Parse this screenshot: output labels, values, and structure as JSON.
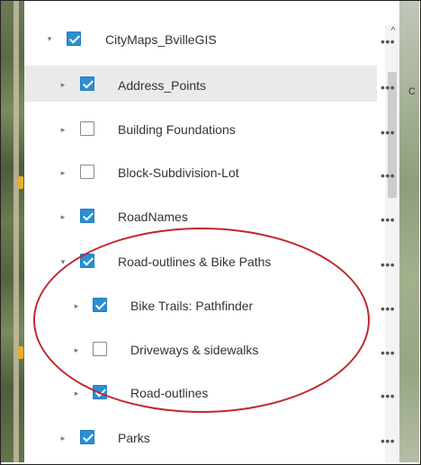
{
  "layers": [
    {
      "label": "CityMaps_BvilleGIS",
      "checked": true,
      "expander": "▾",
      "level": 0
    },
    {
      "label": "Address_Points",
      "checked": true,
      "expander": "▸",
      "level": 1,
      "highlighted": true
    },
    {
      "label": "Building Foundations",
      "checked": false,
      "expander": "▸",
      "level": 1
    },
    {
      "label": "Block-Subdivision-Lot",
      "checked": false,
      "expander": "▸",
      "level": 1
    },
    {
      "label": "RoadNames",
      "checked": true,
      "expander": "▸",
      "level": 1
    },
    {
      "label": "Road-outlines & Bike Paths",
      "checked": true,
      "expander": "▾",
      "level": 1
    },
    {
      "label": "Bike Trails: Pathfinder",
      "checked": true,
      "expander": "▸",
      "level": 2
    },
    {
      "label": "Driveways & sidewalks",
      "checked": false,
      "expander": "▸",
      "level": 2
    },
    {
      "label": "Road-outlines",
      "checked": true,
      "expander": "▸",
      "level": 2
    },
    {
      "label": "Parks",
      "checked": true,
      "expander": "▸",
      "level": 1
    }
  ],
  "more_label": "•••",
  "scroll_up_glyph": "^",
  "annotation_color": "#c0282e",
  "accent_color": "#2b8fd4"
}
